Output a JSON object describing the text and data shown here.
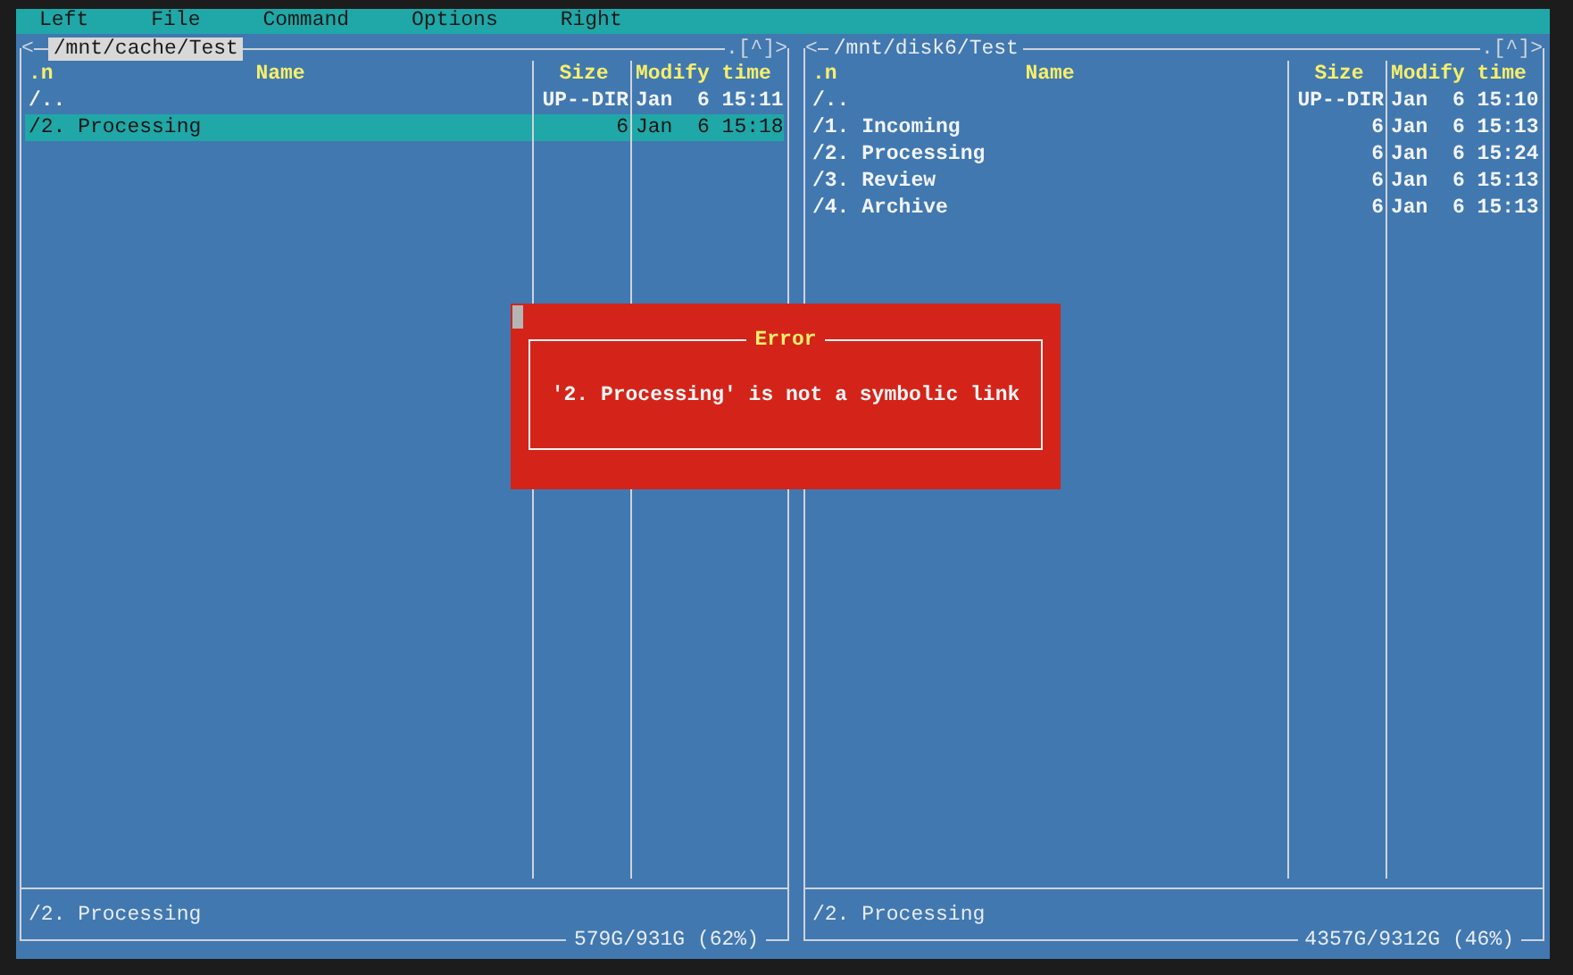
{
  "menu": [
    "Left",
    "File",
    "Command",
    "Options",
    "Right"
  ],
  "panels": [
    {
      "nav_left": "<",
      "path": "/mnt/cache/Test",
      "active": true,
      "nav_right": ".[^]>",
      "columns": {
        "sort": ".n",
        "name": "Name",
        "size": "Size",
        "time": "Modify time"
      },
      "rows": [
        {
          "name": "/..",
          "size": "UP--DIR",
          "time": "Jan  6 15:11",
          "selected": false
        },
        {
          "name": "/2. Processing",
          "size": "6",
          "time": "Jan  6 15:18",
          "selected": true
        }
      ],
      "mini_status": "/2. Processing",
      "free_space": "579G/931G (62%)"
    },
    {
      "nav_left": "<",
      "path": "/mnt/disk6/Test",
      "active": false,
      "nav_right": ".[^]>",
      "columns": {
        "sort": ".n",
        "name": "Name",
        "size": "Size",
        "time": "Modify time"
      },
      "rows": [
        {
          "name": "/..",
          "size": "UP--DIR",
          "time": "Jan  6 15:10",
          "selected": false
        },
        {
          "name": "/1. Incoming",
          "size": "6",
          "time": "Jan  6 15:13",
          "selected": false
        },
        {
          "name": "/2. Processing",
          "size": "6",
          "time": "Jan  6 15:24",
          "selected": false
        },
        {
          "name": "/3. Review",
          "size": "6",
          "time": "Jan  6 15:13",
          "selected": false
        },
        {
          "name": "/4. Archive",
          "size": "6",
          "time": "Jan  6 15:13",
          "selected": false
        }
      ],
      "mini_status": "/2. Processing",
      "free_space": "4357G/9312G (46%)"
    }
  ],
  "dialog": {
    "title": "Error",
    "message": "'2. Processing' is not a symbolic link"
  }
}
